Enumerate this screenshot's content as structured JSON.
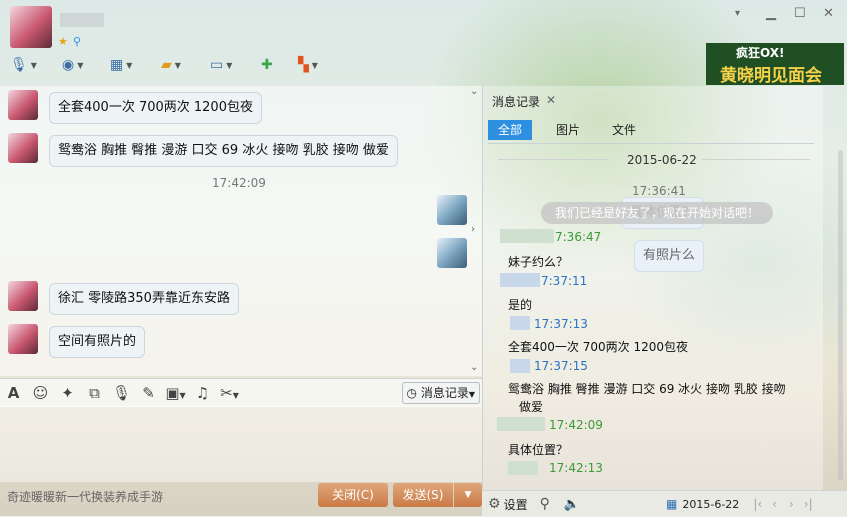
{
  "window": {
    "minimize_icon": "▁",
    "maximize_icon": "☐",
    "close_icon": "✕"
  },
  "toolbar": {
    "tools": [
      "microphone-icon",
      "camera-icon",
      "screen-share-icon",
      "file-transfer-icon",
      "remote-assist-icon",
      "add-chat-icon",
      "apps-icon"
    ]
  },
  "ad_banner": {
    "line1": "疯狂OX!",
    "line2": "黄晓明见面会"
  },
  "chat": {
    "messages": [
      {
        "from": "them",
        "text": "全套400一次 700两次 1200包夜"
      },
      {
        "from": "them",
        "text": "鸳鸯浴 胸推  臀推  漫游 口交 69  冰火 接吻  乳胶  接吻   做爱"
      },
      {
        "timestamp": "17:42:09"
      },
      {
        "from": "me",
        "text": "具体位置？"
      },
      {
        "from": "me",
        "text": "有照片么"
      },
      {
        "from": "them",
        "text": "徐汇 零陵路350弄靠近东安路"
      },
      {
        "from": "them",
        "text": "空间有照片的"
      }
    ]
  },
  "input_toolbar": {
    "history_label": "消息记录"
  },
  "bottom": {
    "ad_text": "奇迹暖暖新一代换装养成手游",
    "close_label": "关闭(C)",
    "send_label": "发送(S)"
  },
  "history": {
    "title": "消息记录",
    "tabs": [
      "全部",
      "图片",
      "文件"
    ],
    "date": "2015-06-22",
    "first_time": "17:36:41",
    "system_notice": "我们已经是好友了，现在开始对话吧！",
    "entries": [
      {
        "time": "7:36:47",
        "text": "妹子约么？"
      },
      {
        "time": "7:37:11",
        "text": "是的"
      },
      {
        "time": "17:37:13",
        "text": "全套400一次 700两次 1200包夜"
      },
      {
        "time": "17:37:15",
        "text": "鸳鸯浴 胸推  臀推  漫游 口交 69  冰火 接吻  乳胶  接吻"
      },
      {
        "time": "",
        "text": "做爱"
      },
      {
        "time": "17:42:09",
        "text": "具体位置？"
      },
      {
        "time": "17:42:13",
        "text": ""
      }
    ],
    "settings_label": "设置",
    "date_filter": "2015-6-22"
  }
}
